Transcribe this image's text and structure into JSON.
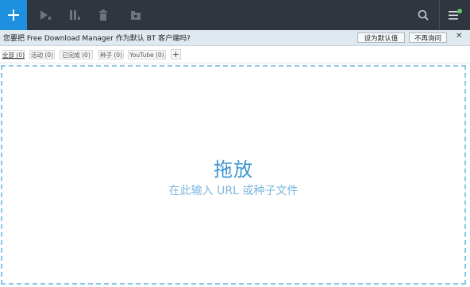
{
  "toolbar": {
    "add": "add-icon",
    "start": "play-icon",
    "pause": "pause-icon",
    "delete": "trash-icon",
    "move": "folder-icon",
    "search": "search-icon",
    "menu": "menu-icon",
    "menu_badge_color": "#5cc95c",
    "accent": "#1e90e0"
  },
  "notice": {
    "text": "您要把 Free Download Manager 作为默认 BT 客户端吗?",
    "set_default_label": "设为默认值",
    "never_ask_label": "不再询问",
    "close_label": "✕"
  },
  "tabs": [
    {
      "label": "全部 (0)",
      "active": true
    },
    {
      "label": "活动 (0)"
    },
    {
      "label": "已完成 (0)"
    },
    {
      "label": "种子 (0)"
    },
    {
      "label": "YouTube (0)"
    }
  ],
  "tab_add_label": "+",
  "drop_zone": {
    "title": "拖放",
    "subtitle": "在此输入 URL 或种子文件"
  }
}
